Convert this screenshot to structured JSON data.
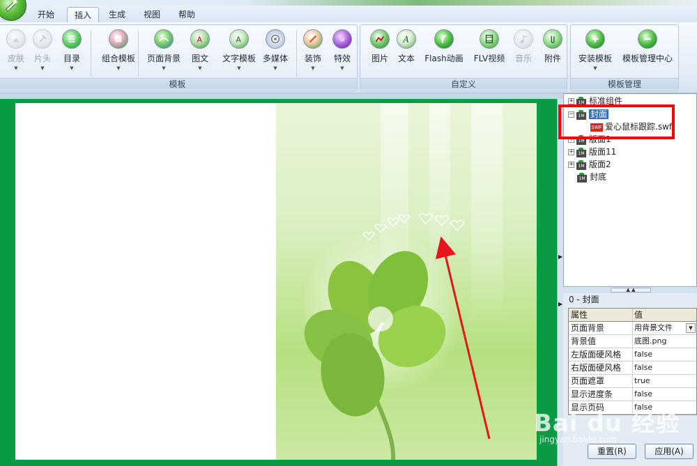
{
  "tabs": [
    "开始",
    "插入",
    "生成",
    "视图",
    "帮助"
  ],
  "active_tab": "插入",
  "ribbon": {
    "groups": [
      {
        "label": "模板",
        "buttons": [
          {
            "label": "皮肤",
            "icon": "skin-icon",
            "dropdown": true,
            "disabled": true
          },
          {
            "label": "片头",
            "icon": "intro-icon",
            "dropdown": true,
            "disabled": true
          },
          {
            "label": "目录",
            "icon": "toc-icon",
            "dropdown": true,
            "disabled": false
          },
          {
            "label": "组合模板",
            "icon": "combo-template-icon",
            "dropdown": true,
            "disabled": false
          },
          {
            "label": "页面背景",
            "icon": "page-background-icon",
            "dropdown": true,
            "disabled": false
          },
          {
            "label": "图文",
            "icon": "image-text-icon",
            "dropdown": true,
            "disabled": false
          },
          {
            "label": "文字模板",
            "icon": "text-template-icon",
            "dropdown": true,
            "disabled": false
          },
          {
            "label": "多媒体",
            "icon": "multimedia-icon",
            "dropdown": true,
            "disabled": false
          },
          {
            "label": "装饰",
            "icon": "decoration-icon",
            "dropdown": true,
            "disabled": false
          },
          {
            "label": "特效",
            "icon": "effects-icon",
            "dropdown": true,
            "disabled": false
          }
        ]
      },
      {
        "label": "自定义",
        "buttons": [
          {
            "label": "图片",
            "icon": "picture-icon",
            "dropdown": false,
            "disabled": false
          },
          {
            "label": "文本",
            "icon": "text-icon",
            "dropdown": false,
            "disabled": false
          },
          {
            "label": "Flash动画",
            "icon": "flash-icon",
            "dropdown": false,
            "disabled": false
          },
          {
            "label": "FLV视频",
            "icon": "video-icon",
            "dropdown": false,
            "disabled": false
          },
          {
            "label": "音乐",
            "icon": "music-icon",
            "dropdown": false,
            "disabled": true
          },
          {
            "label": "附件",
            "icon": "attachment-icon",
            "dropdown": false,
            "disabled": false
          }
        ]
      },
      {
        "label": "模板管理",
        "buttons": [
          {
            "label": "安装模板",
            "icon": "install-template-icon",
            "dropdown": true,
            "disabled": false
          },
          {
            "label": "模板管理中心",
            "icon": "template-manager-icon",
            "dropdown": false,
            "disabled": false
          }
        ]
      }
    ]
  },
  "tree": {
    "items": [
      {
        "label": "标准组件",
        "expander": "+",
        "type": "page"
      },
      {
        "label": "封面",
        "expander": "−",
        "type": "page",
        "selected": true
      },
      {
        "label": "爱心鼠标跟踪.swf",
        "expander": "",
        "type": "swf"
      },
      {
        "label": "版面1",
        "expander": "+",
        "type": "page"
      },
      {
        "label": "版面11",
        "expander": "+",
        "type": "page"
      },
      {
        "label": "版面2",
        "expander": "+",
        "type": "page"
      },
      {
        "label": "封底",
        "expander": "",
        "type": "page"
      }
    ],
    "swf_badge": "SWF",
    "page_badge": "1M"
  },
  "properties": {
    "header": "0 - 封面",
    "col_key": "属性",
    "col_value": "值",
    "rows": [
      {
        "key": "页面背景",
        "value": "用背景文件",
        "dropdown": true
      },
      {
        "key": "背景值",
        "value": "底图.png"
      },
      {
        "key": "左版面硬风格",
        "value": "false"
      },
      {
        "key": "右版面硬风格",
        "value": "false"
      },
      {
        "key": "页面遮罩",
        "value": "true"
      },
      {
        "key": "显示进度条",
        "value": "false"
      },
      {
        "key": "显示页码",
        "value": "false"
      }
    ]
  },
  "buttons": {
    "reset": "重置(R)",
    "apply": "应用(A)"
  },
  "watermark": {
    "main": "Bai du 经验",
    "sub": "jingyan.baidu.com"
  },
  "colors": {
    "canvas_bg": "#0a9a44",
    "highlight": "#ff0000",
    "arrow": "#e8141b",
    "selection": "#316ac5"
  }
}
